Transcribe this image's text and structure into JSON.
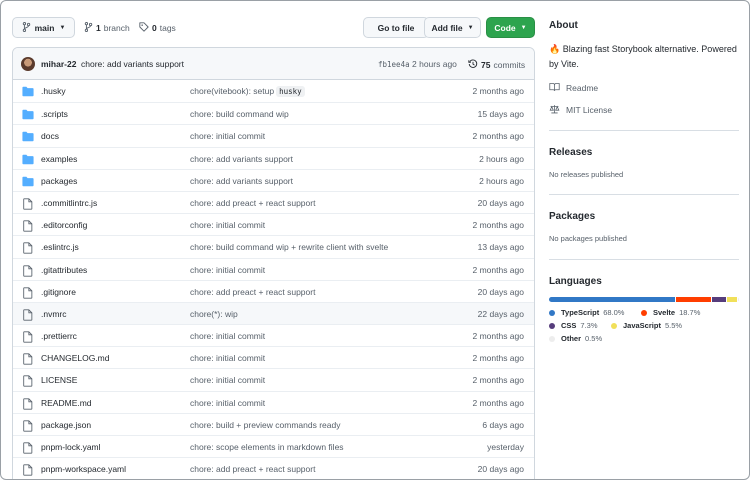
{
  "toolbar": {
    "branch_label": "main",
    "branch_count": "1",
    "branch_word": "branch",
    "tag_count": "0",
    "tag_word": "tags",
    "goto_label": "Go to file",
    "addfile_label": "Add file",
    "code_label": "Code"
  },
  "commit": {
    "author": "mihar-22",
    "message": "chore: add variants support",
    "hash": "fb1ee4a",
    "time": "2 hours ago",
    "count": "75",
    "count_word": "commits"
  },
  "files": [
    {
      "type": "folder",
      "name": ".husky",
      "msg": "chore(vitebook): setup",
      "code": "husky",
      "time": "2 months ago"
    },
    {
      "type": "folder",
      "name": ".scripts",
      "msg": "chore: build command wip",
      "time": "15 days ago"
    },
    {
      "type": "folder",
      "name": "docs",
      "msg": "chore: initial commit",
      "time": "2 months ago"
    },
    {
      "type": "folder",
      "name": "examples",
      "msg": "chore: add variants support",
      "time": "2 hours ago"
    },
    {
      "type": "folder",
      "name": "packages",
      "msg": "chore: add variants support",
      "time": "2 hours ago"
    },
    {
      "type": "file",
      "name": ".commitlintrc.js",
      "msg": "chore: add preact + react support",
      "time": "20 days ago"
    },
    {
      "type": "file",
      "name": ".editorconfig",
      "msg": "chore: initial commit",
      "time": "2 months ago"
    },
    {
      "type": "file",
      "name": ".eslintrc.js",
      "msg": "chore: build command wip + rewrite client with svelte",
      "time": "13 days ago"
    },
    {
      "type": "file",
      "name": ".gitattributes",
      "msg": "chore: initial commit",
      "time": "2 months ago"
    },
    {
      "type": "file",
      "name": ".gitignore",
      "msg": "chore: add preact + react support",
      "time": "20 days ago"
    },
    {
      "type": "file",
      "name": ".nvmrc",
      "msg": "chore(*): wip",
      "time": "22 days ago"
    },
    {
      "type": "file",
      "name": ".prettierrc",
      "msg": "chore: initial commit",
      "time": "2 months ago"
    },
    {
      "type": "file",
      "name": "CHANGELOG.md",
      "msg": "chore: initial commit",
      "time": "2 months ago"
    },
    {
      "type": "file",
      "name": "LICENSE",
      "msg": "chore: initial commit",
      "time": "2 months ago"
    },
    {
      "type": "file",
      "name": "README.md",
      "msg": "chore: initial commit",
      "time": "2 months ago"
    },
    {
      "type": "file",
      "name": "package.json",
      "msg": "chore: build + preview commands ready",
      "time": "6 days ago"
    },
    {
      "type": "file",
      "name": "pnpm-lock.yaml",
      "msg": "chore: scope elements in markdown files",
      "time": "yesterday"
    },
    {
      "type": "file",
      "name": "pnpm-workspace.yaml",
      "msg": "chore: add preact + react support",
      "time": "20 days ago"
    }
  ],
  "sidebar": {
    "about_title": "About",
    "about_emoji": "🔥",
    "about_desc": "Blazing fast Storybook alternative. Powered by Vite.",
    "readme_label": "Readme",
    "license_label": "MIT License",
    "releases_title": "Releases",
    "releases_none": "No releases published",
    "packages_title": "Packages",
    "packages_none": "No packages published",
    "languages_title": "Languages",
    "languages": [
      {
        "name": "TypeScript",
        "pct": "68.0%",
        "value": 68.0,
        "color": "#3178c6"
      },
      {
        "name": "Svelte",
        "pct": "18.7%",
        "value": 18.7,
        "color": "#ff3e00"
      },
      {
        "name": "CSS",
        "pct": "7.3%",
        "value": 7.3,
        "color": "#563d7c"
      },
      {
        "name": "JavaScript",
        "pct": "5.5%",
        "value": 5.5,
        "color": "#f1e05a"
      },
      {
        "name": "Other",
        "pct": "0.5%",
        "value": 0.5,
        "color": "#ededed"
      }
    ]
  }
}
